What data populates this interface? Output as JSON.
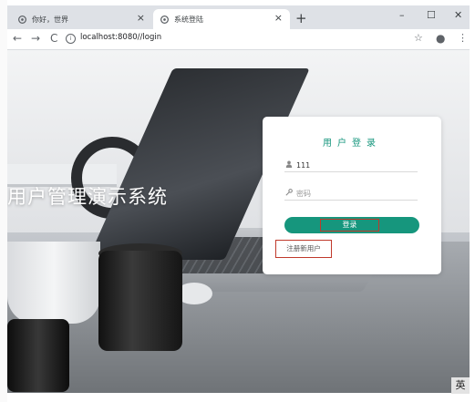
{
  "tabs": [
    {
      "label": "你好，世界",
      "close": "×"
    },
    {
      "label": "系统登陆",
      "close": "×"
    }
  ],
  "new_tab": "+",
  "window_controls": {
    "minimize": "–",
    "maximize": "☐",
    "close": "✕"
  },
  "nav": {
    "back": "←",
    "forward": "→",
    "reload": "C"
  },
  "address_bar": {
    "url": "localhost:8080//login"
  },
  "toolbar_icons": {
    "star": "☆",
    "profile": "●",
    "menu": "⋮"
  },
  "page": {
    "system_title": "用户管理演示系统",
    "login": {
      "title": "用户登录",
      "username_value": "111",
      "password_placeholder": "密码",
      "login_button": "登录",
      "register_link": "注册新用户"
    }
  },
  "ime_indicator": "英"
}
